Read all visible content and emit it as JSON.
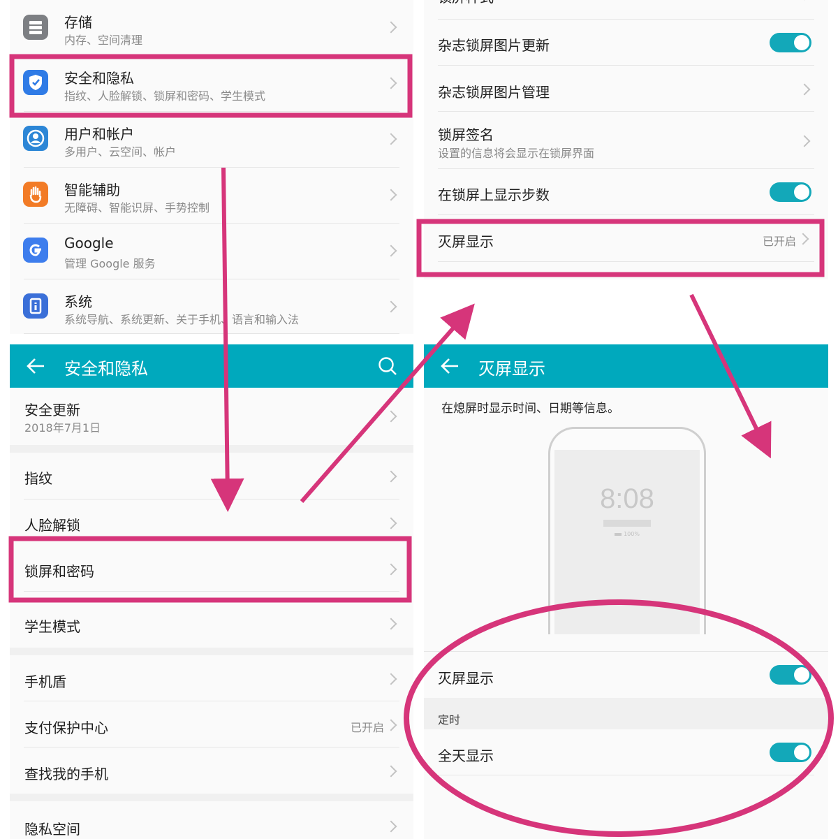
{
  "settings_main": {
    "items": [
      {
        "title": "存储",
        "subtitle": "内存、空间清理",
        "icon": "storage-icon"
      },
      {
        "title": "安全和隐私",
        "subtitle": "指纹、人脸解锁、锁屏和密码、学生模式",
        "icon": "shield-icon"
      },
      {
        "title": "用户和帐户",
        "subtitle": "多用户、云空间、帐户",
        "icon": "user-account-icon"
      },
      {
        "title": "智能辅助",
        "subtitle": "无障碍、智能识屏、手势控制",
        "icon": "hand-icon"
      },
      {
        "title": "Google",
        "subtitle": "管理 Google 服务",
        "icon": "google-icon"
      },
      {
        "title": "系统",
        "subtitle": "系统导航、系统更新、关于手机、语言和输入法",
        "icon": "system-icon"
      }
    ]
  },
  "security": {
    "header_title": "安全和隐私",
    "security_update": {
      "title": "安全更新",
      "date": "2018年7月1日"
    },
    "fingerprint": "指纹",
    "face_unlock": "人脸解锁",
    "lock_screen_password": "锁屏和密码",
    "student_mode": "学生模式",
    "phone_shield": "手机盾",
    "payment_center": {
      "title": "支付保护中心",
      "value": "已开启"
    },
    "find_my_phone": "查找我的手机",
    "private_space": "隐私空间"
  },
  "lockscreen": {
    "partial_title": "锁屏样式",
    "magazine_update": "杂志锁屏图片更新",
    "magazine_manage": "杂志锁屏图片管理",
    "signature": {
      "title": "锁屏签名",
      "subtitle": "设置的信息将会显示在锁屏界面"
    },
    "show_steps": "在锁屏上显示步数",
    "aod": {
      "title": "灭屏显示",
      "value": "已开启"
    },
    "toggles": {
      "magazine_update": true,
      "show_steps": true
    }
  },
  "aod_page": {
    "header_title": "灭屏显示",
    "description": "在熄屏时显示时间、日期等信息。",
    "preview_time": "8:08",
    "preview_battery": "100%",
    "aod_toggle_label": "灭屏显示",
    "timing_section": "定时",
    "all_day_label": "全天显示",
    "toggles": {
      "aod": true,
      "all_day": true
    }
  },
  "colors": {
    "accent_teal": "#00a9bd",
    "toggle_on": "#13a8b9",
    "annotation_pink": "#d6357a"
  }
}
